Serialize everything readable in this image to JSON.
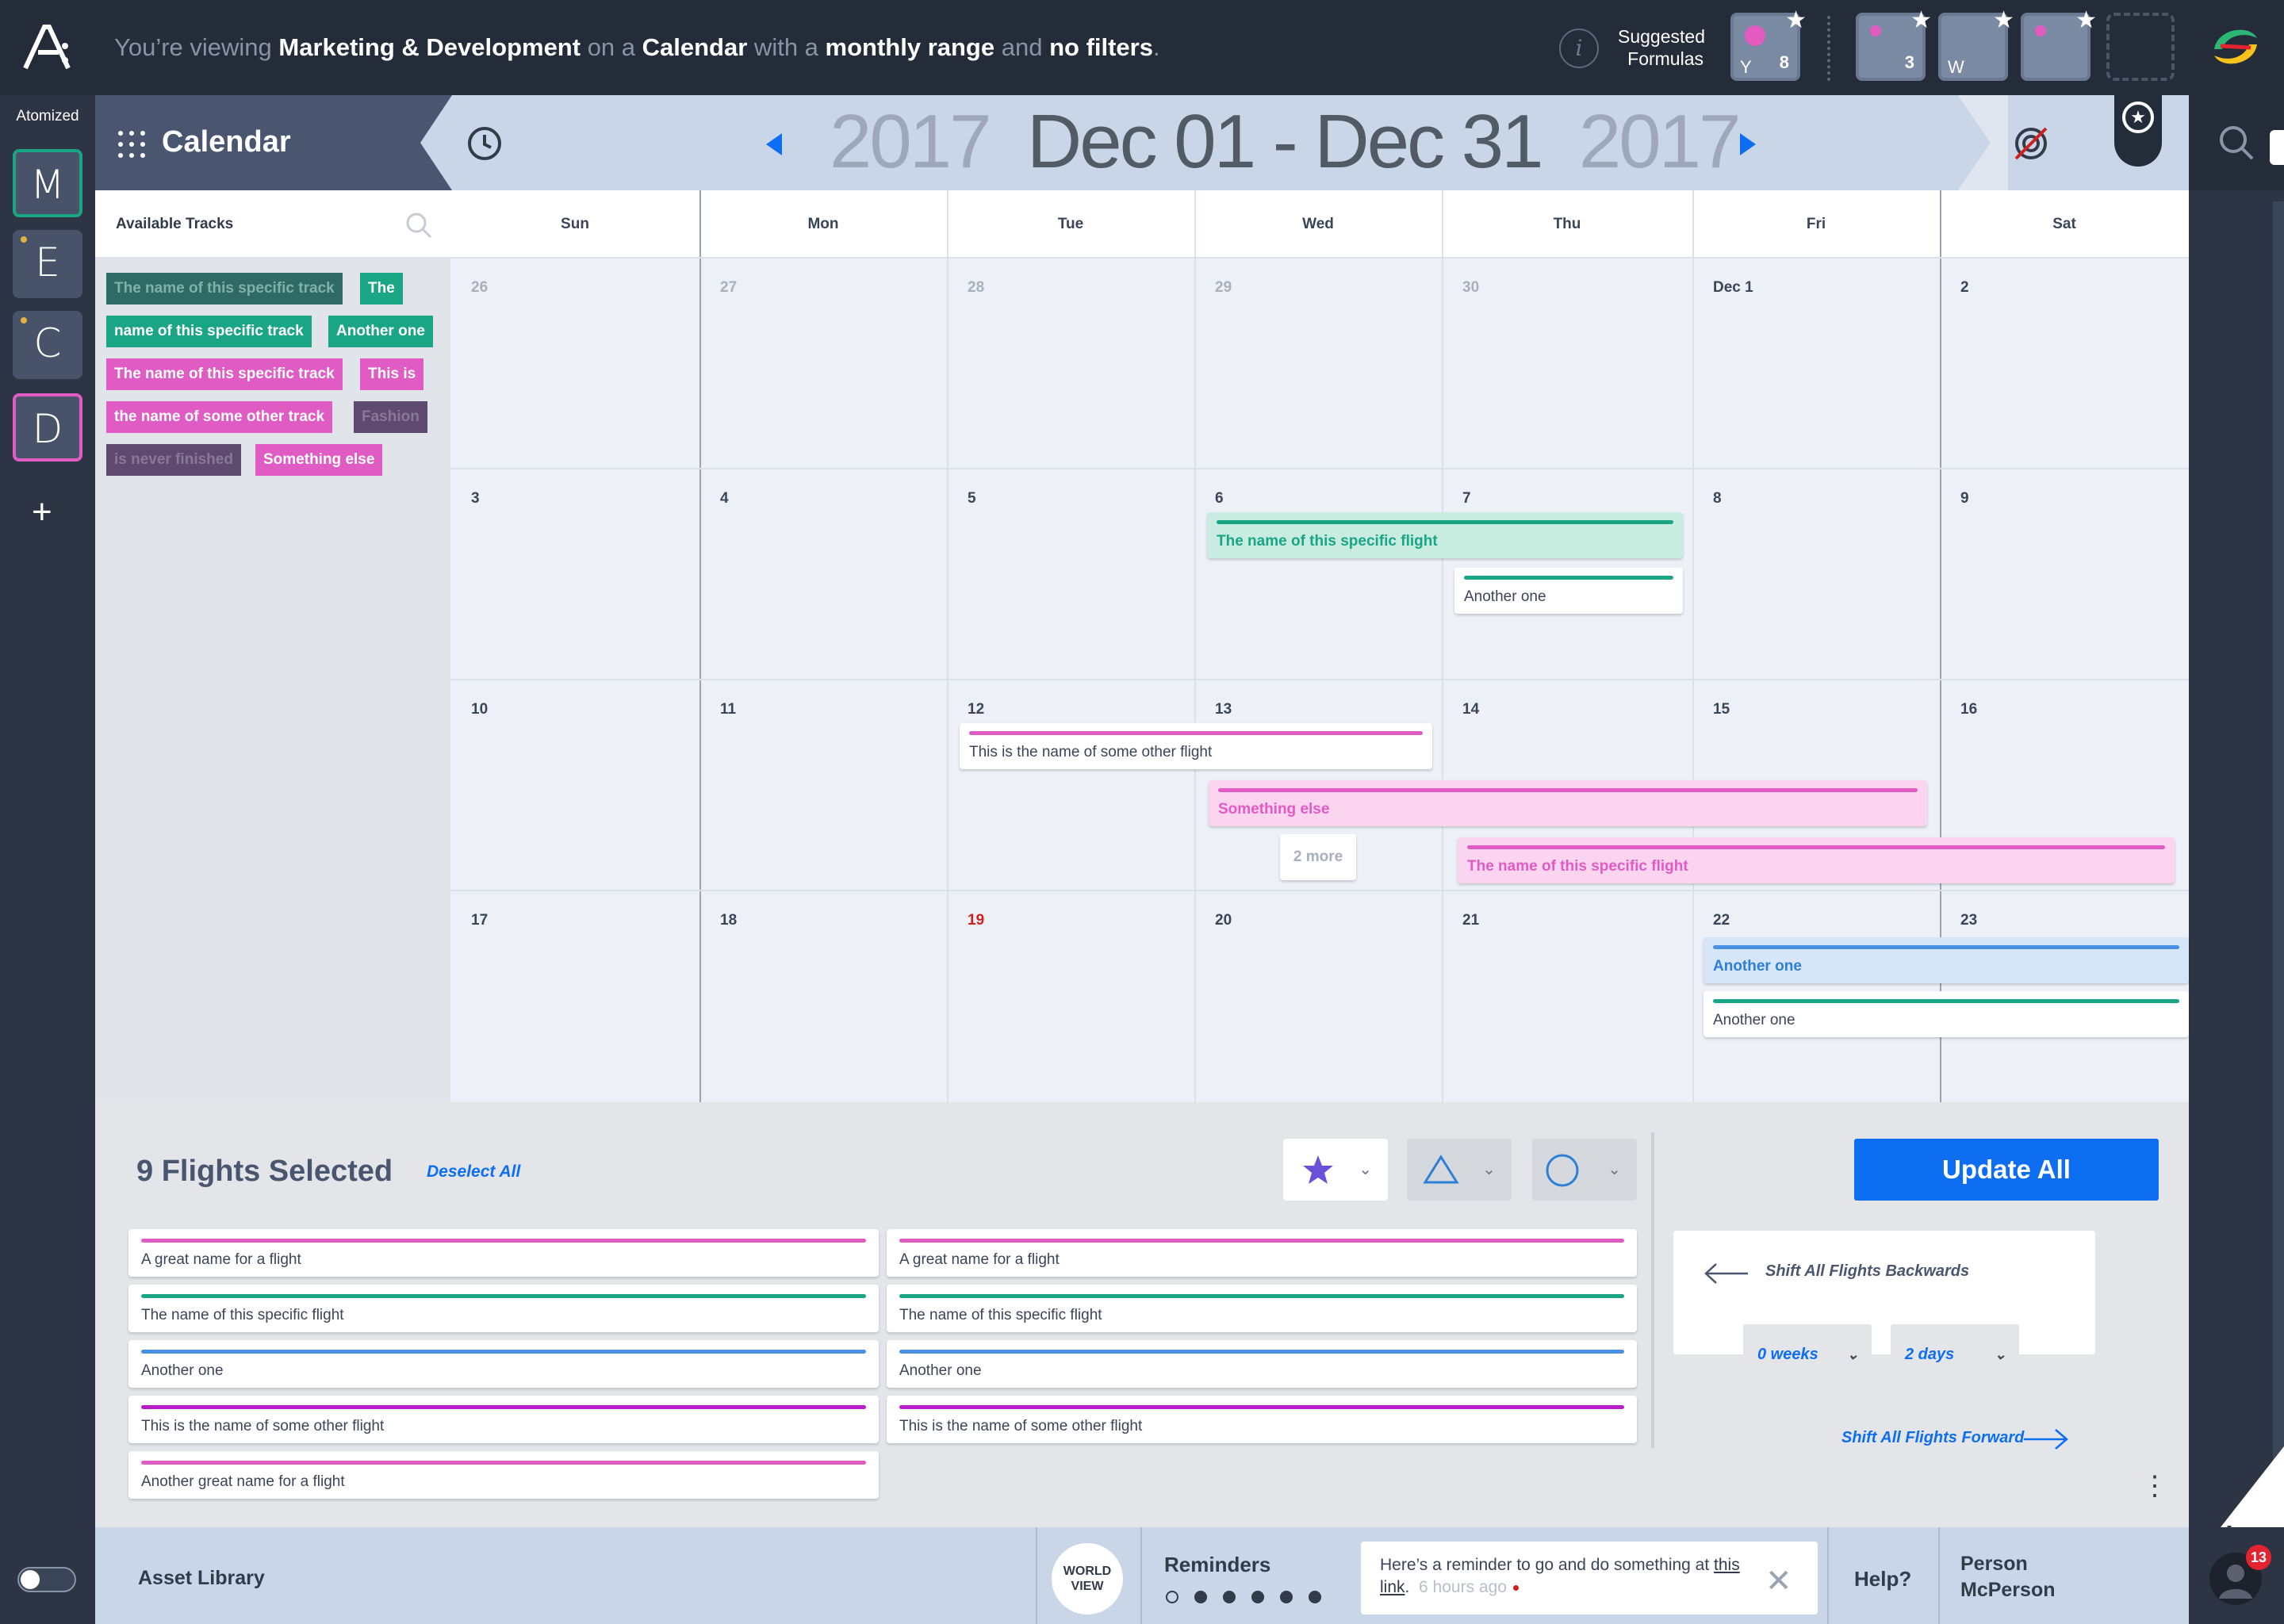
{
  "topbar": {
    "viewing": {
      "p1": "You’re viewing ",
      "workspace": "Marketing & Development",
      "p2": " on a ",
      "view": "Calendar",
      "p3": " with a ",
      "range": "monthly range",
      "p4": " and ",
      "filters": "no filters",
      "p5": "."
    },
    "suggested_label": "Suggested Formulas",
    "formulas": [
      {
        "glyph": "Y",
        "num": "8"
      },
      {
        "glyph": "",
        "num": "3"
      },
      {
        "glyph": "W",
        "num": ""
      },
      {
        "glyph": "",
        "num": ""
      }
    ]
  },
  "rail": {
    "title": "Atomized",
    "workspaces": [
      {
        "letter": "M",
        "color": "#1aa585"
      },
      {
        "letter": "E",
        "color": "#e0b040"
      },
      {
        "letter": "C",
        "color": "#e0b040"
      },
      {
        "letter": "D",
        "color": "#e15bc4"
      }
    ],
    "add": "+"
  },
  "header": {
    "title": "Calendar",
    "year_start": "2017",
    "range": "Dec 01 - Dec 31",
    "year_end": "2017"
  },
  "tracks": {
    "title": "Available Tracks",
    "items": [
      {
        "text": "The name of this specific track",
        "bg": "#2f6b64",
        "fg": "#7fb0aa"
      },
      {
        "text": "The",
        "bg": "#1aa585",
        "fg": "#ffffff"
      },
      {
        "text": "name of this specific track",
        "bg": "#1aa585",
        "fg": "#ffffff"
      },
      {
        "text": "Another one",
        "bg": "#1aa585",
        "fg": "#ffffff"
      },
      {
        "text": "The name of this specific track",
        "bg": "#e15bc4",
        "fg": "#ffffff"
      },
      {
        "text": "This is",
        "bg": "#e15bc4",
        "fg": "#ffffff"
      },
      {
        "text": "the name of some other track",
        "bg": "#e15bc4",
        "fg": "#ffffff"
      },
      {
        "text": "Fashion",
        "bg": "#5e4a6e",
        "fg": "#8a7898"
      },
      {
        "text": "is never finished",
        "bg": "#5e4a6e",
        "fg": "#8a7898"
      },
      {
        "text": "Something else",
        "bg": "#e15bc4",
        "fg": "#ffffff"
      }
    ]
  },
  "calendar": {
    "days": [
      "Sun",
      "Mon",
      "Tue",
      "Wed",
      "Thu",
      "Fri",
      "Sat"
    ],
    "weeks": [
      [
        "26",
        "27",
        "28",
        "29",
        "30",
        "Dec 1",
        "2"
      ],
      [
        "3",
        "4",
        "5",
        "6",
        "7",
        "8",
        "9"
      ],
      [
        "10",
        "11",
        "12",
        "13",
        "14",
        "15",
        "16"
      ],
      [
        "17",
        "18",
        "19",
        "20",
        "21",
        "22",
        "23"
      ]
    ],
    "today": "19",
    "events": [
      {
        "label": "The name of this specific flight",
        "color": "#1aa585",
        "bg": "#c8ece0",
        "text": "#1aa585"
      },
      {
        "label": "Another one",
        "color": "#1aa585",
        "bg": "#ffffff",
        "text": "#3b4558"
      },
      {
        "label": "This is the name of some other flight",
        "color": "#e15bc4",
        "bg": "#ffffff",
        "text": "#3b4558"
      },
      {
        "label": "Something else",
        "color": "#e15bc4",
        "bg": "#fbd4ef",
        "text": "#e15bc4"
      },
      {
        "label": "The name of this specific flight",
        "color": "#e15bc4",
        "bg": "#fbd4ef",
        "text": "#e15bc4"
      },
      {
        "label": "Another one",
        "color": "#4a90e2",
        "bg": "#d6e5f7",
        "text": "#2f7fd6"
      },
      {
        "label": "Another one",
        "color": "#1aa585",
        "bg": "#ffffff",
        "text": "#3b4558"
      }
    ],
    "more": "2 more"
  },
  "selection": {
    "title": "9 Flights Selected",
    "deselect": "Deselect All",
    "update": "Update All",
    "flights": [
      {
        "label": "A great name for a flight",
        "color": "#e15bc4"
      },
      {
        "label": "A great name for a flight",
        "color": "#e15bc4"
      },
      {
        "label": "The name of this specific flight",
        "color": "#1aa585"
      },
      {
        "label": "The name of this specific flight",
        "color": "#1aa585"
      },
      {
        "label": "Another one",
        "color": "#4a90e2"
      },
      {
        "label": "Another one",
        "color": "#4a90e2"
      },
      {
        "label": "This is the name of some other flight",
        "color": "#b91ec8"
      },
      {
        "label": "This is the name of some other flight",
        "color": "#b91ec8"
      },
      {
        "label": "Another great name for a flight",
        "color": "#e15bc4"
      }
    ],
    "shift_back": "Shift All Flights Backwards",
    "shift_forward": "Shift All Flights Forward",
    "weeks": "0 weeks",
    "days": "2 days"
  },
  "bottom": {
    "asset": "Asset Library",
    "world": "WORLD VIEW",
    "reminders": "Reminders",
    "reminder_text": "Here’s a reminder to go and do something at ",
    "reminder_link": "this link",
    "reminder_after": ".",
    "reminder_time": "6 hours ago",
    "help": "Help?",
    "person_first": "Person",
    "person_last": "McPerson",
    "notif_count": "13"
  }
}
